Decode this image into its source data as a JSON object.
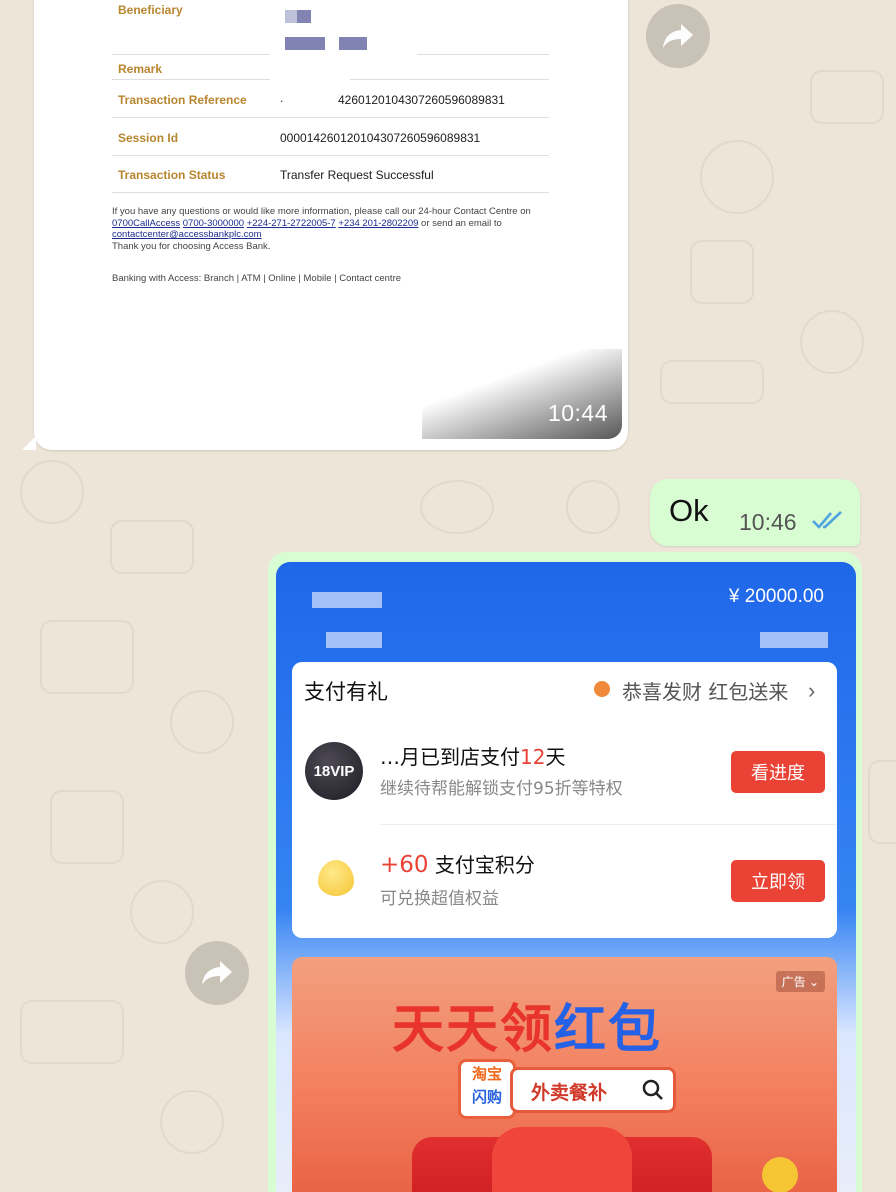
{
  "receipt": {
    "beneficiary_label": "Beneficiary",
    "remark_label": "Remark",
    "reference_label": "Transaction Reference",
    "reference_prefix": ".",
    "reference_value": "426012010430726059608983​1",
    "session_label": "Session Id",
    "session_value": "000014260120104307260596089831",
    "status_label": "Transaction Status",
    "status_value": "Transfer Request Successful",
    "contact_line1": "If you have any questions or would like more information, please call our 24-hour Contact Centre on",
    "contact_phone1": "0700CallAccess",
    "contact_phone2": "0700-3000000",
    "contact_phone3": "+224-271-2722005-7",
    "contact_phone4": "+234 201-2802209",
    "contact_email_text": "or send an email to",
    "contact_email": "contactcenter@accessbankplc.com",
    "thanks": "Thank you for choosing Access Bank.",
    "footer": "Banking with Access: Branch | ATM | Online | Mobile | Contact centre",
    "time": "10:44"
  },
  "ok_message": {
    "text": "Ok",
    "time": "10:46",
    "status_icon": "double-check-icon"
  },
  "alipay": {
    "amount": "¥ 20000.00",
    "card_title": "支付有礼",
    "card_promo": "恭喜发财 红包送来",
    "vip_badge": "18VIP",
    "vip_title_pre": "…月已到店支付",
    "vip_title_num": "12",
    "vip_title_post": "天",
    "vip_sub": "继续待帮能解锁支付95折等特权",
    "vip_button": "看进度",
    "points_num": "+60",
    "points_title": "支付宝积分",
    "points_sub": "可兑换超值权益",
    "points_button": "立即领",
    "banner_ad": "广告",
    "banner_title_1": "天天领",
    "banner_title_2": "红包",
    "banner_logo_line1": "淘宝",
    "banner_logo_line2": "闪购",
    "banner_search": "外卖餐补"
  },
  "colors": {
    "wallpaper": "#ece5d8",
    "outgoing_bubble": "#d8fdd2",
    "receipt_label": "#b8862f",
    "alipay_blue": "#1f67ea",
    "alipay_button_red": "#ea4336",
    "check_blue": "#4fa3e0"
  }
}
